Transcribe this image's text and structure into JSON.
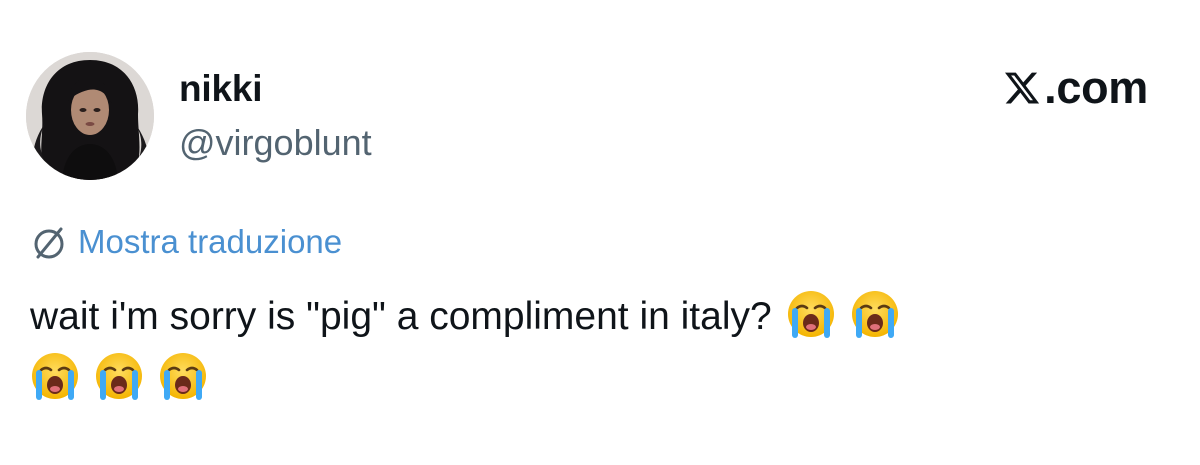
{
  "author": {
    "display_name": "nikki",
    "handle": "@virgoblunt"
  },
  "brand": {
    "icon": "x-logo-icon",
    "label": ".com"
  },
  "translate": {
    "icon": "globe-icon",
    "label": "Mostra traduzione",
    "color": "#4a90d1"
  },
  "tweet": {
    "text": "wait i'm sorry is \"pig\" a compliment in italy?",
    "emoji": [
      "loudly-crying-face",
      "loudly-crying-face",
      "loudly-crying-face",
      "loudly-crying-face",
      "loudly-crying-face"
    ]
  },
  "colors": {
    "text": "#0f1419",
    "secondary": "#536471",
    "link": "#4a90d1"
  }
}
